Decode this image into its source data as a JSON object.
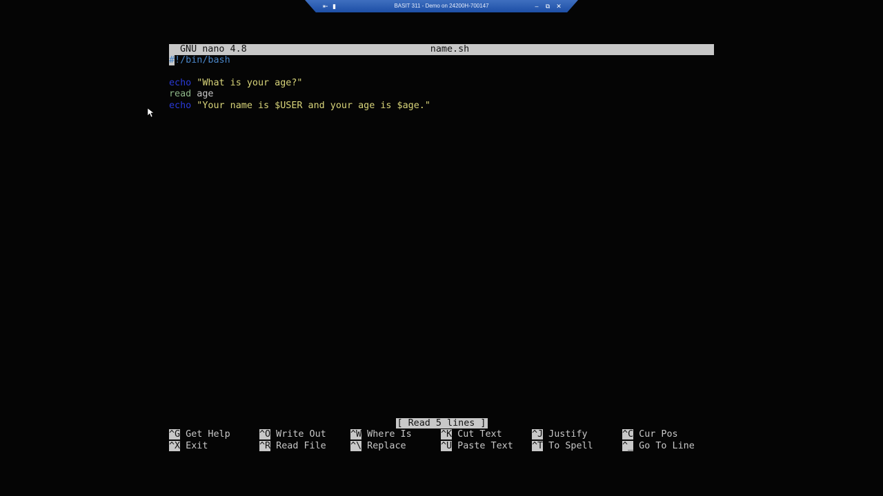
{
  "rdp": {
    "title": "BASIT 311 - Demo on 24200H-700147",
    "pin_icon": "pin-icon",
    "signal_icon": "signal-icon",
    "minimize": "–",
    "restore": "⧉",
    "close": "✕"
  },
  "nano": {
    "version": "GNU nano 4.8",
    "filename": "name.sh",
    "lines": {
      "l1_cursor": "#",
      "l1_rest": "!/bin/bash",
      "l3_kw": "echo",
      "l3_str": " \"What is your age?\"",
      "l4_kw": "read",
      "l4_rest": " age",
      "l5_kw": "echo",
      "l5_str": " \"Your name is $USER and your age is $age.\""
    },
    "status": "[ Read 5 lines ]",
    "shortcuts": [
      {
        "key": "^G",
        "label": " Get Help"
      },
      {
        "key": "^O",
        "label": " Write Out"
      },
      {
        "key": "^W",
        "label": " Where Is"
      },
      {
        "key": "^K",
        "label": " Cut Text"
      },
      {
        "key": "^J",
        "label": " Justify"
      },
      {
        "key": "^C",
        "label": " Cur Pos"
      },
      {
        "key": "^X",
        "label": " Exit"
      },
      {
        "key": "^R",
        "label": " Read File"
      },
      {
        "key": "^\\",
        "label": " Replace"
      },
      {
        "key": "^U",
        "label": " Paste Text"
      },
      {
        "key": "^T",
        "label": " To Spell"
      },
      {
        "key": "^_",
        "label": " Go To Line"
      }
    ]
  },
  "colors": {
    "background": "#050505",
    "text": "#c8c8c8",
    "keyword_echo": "#2a3ad8",
    "keyword_read": "#8fb98a",
    "string": "#d9d57a",
    "shebang": "#4a86c8"
  }
}
